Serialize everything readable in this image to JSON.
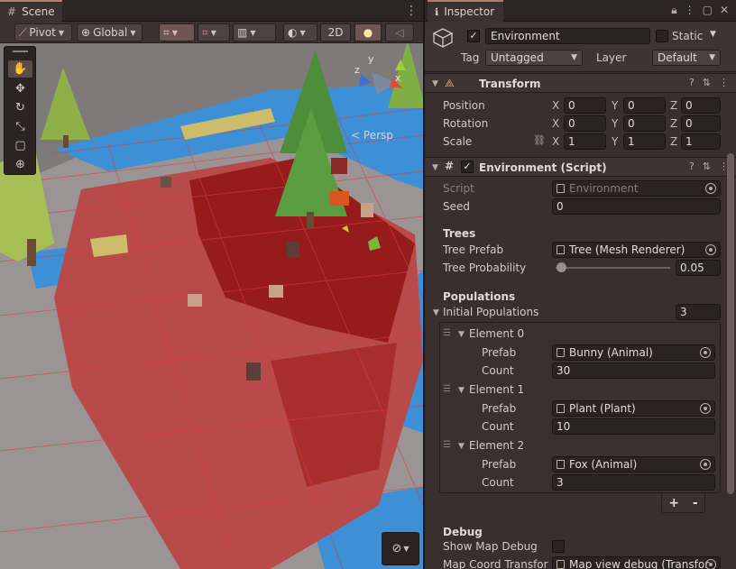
{
  "scene": {
    "tab_label": "Scene",
    "pivot_label": "Pivot",
    "global_label": "Global",
    "mode_2d_label": "2D",
    "persp_label": "Persp",
    "gizmo_axes": {
      "x": "x",
      "y": "y",
      "z": "z"
    }
  },
  "inspector": {
    "tab_label": "Inspector",
    "object": {
      "name": "Environment",
      "active": true,
      "static_label": "Static",
      "static": false,
      "tag_label": "Tag",
      "tag_value": "Untagged",
      "layer_label": "Layer",
      "layer_value": "Default"
    },
    "transform": {
      "title": "Transform",
      "position_label": "Position",
      "rotation_label": "Rotation",
      "scale_label": "Scale",
      "axis_x": "X",
      "axis_y": "Y",
      "axis_z": "Z",
      "position": {
        "x": "0",
        "y": "0",
        "z": "0"
      },
      "rotation": {
        "x": "0",
        "y": "0",
        "z": "0"
      },
      "scale": {
        "x": "1",
        "y": "1",
        "z": "1"
      }
    },
    "script_component": {
      "title": "Environment (Script)",
      "enabled": true,
      "script_label": "Script",
      "script_value": "Environment",
      "seed_label": "Seed",
      "seed_value": "0",
      "trees_header": "Trees",
      "tree_prefab_label": "Tree Prefab",
      "tree_prefab_value": "Tree (Mesh Renderer)",
      "tree_probability_label": "Tree Probability",
      "tree_probability_value": "0.05",
      "tree_probability_fraction": 0.05,
      "populations_header": "Populations",
      "initial_populations_label": "Initial Populations",
      "initial_populations_count": "3",
      "elements": [
        {
          "label": "Element 0",
          "prefab_label": "Prefab",
          "prefab_value": "Bunny (Animal)",
          "count_label": "Count",
          "count_value": "30"
        },
        {
          "label": "Element 1",
          "prefab_label": "Prefab",
          "prefab_value": "Plant (Plant)",
          "count_label": "Count",
          "count_value": "10"
        },
        {
          "label": "Element 2",
          "prefab_label": "Prefab",
          "prefab_value": "Fox (Animal)",
          "count_label": "Count",
          "count_value": "3"
        }
      ],
      "add_label": "+",
      "remove_label": "-",
      "debug_header": "Debug",
      "show_map_debug_label": "Show Map Debug",
      "show_map_debug": false,
      "map_coord_label": "Map Coord Transfor",
      "map_coord_value": "Map view debug (Transfor"
    }
  }
}
